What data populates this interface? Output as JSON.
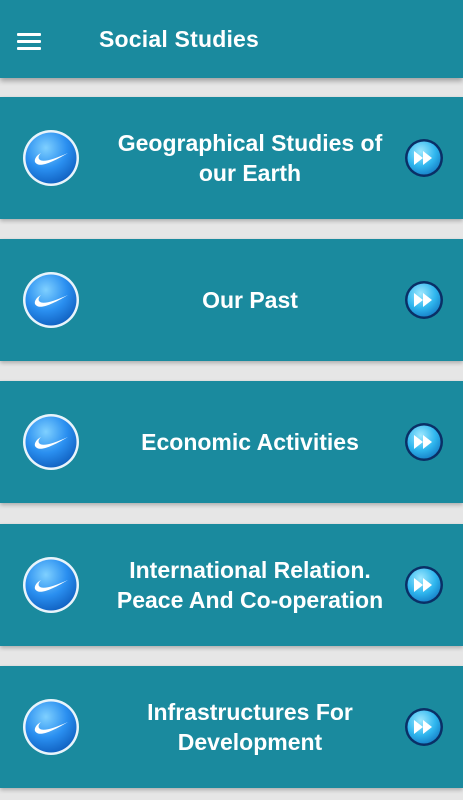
{
  "appbar": {
    "title": "Social Studies",
    "menu_icon": "hamburger-menu-icon"
  },
  "theme": {
    "primary": "#1a8a9e",
    "background": "#e6e6e6",
    "text": "#ffffff",
    "icon_blue": "#1a7fd6"
  },
  "items": [
    {
      "label": "Geographical Studies of our Earth",
      "left_icon": "swoosh-logo-icon",
      "right_icon": "fast-forward-icon"
    },
    {
      "label": "Our Past",
      "left_icon": "swoosh-logo-icon",
      "right_icon": "fast-forward-icon"
    },
    {
      "label": "Economic Activities",
      "left_icon": "swoosh-logo-icon",
      "right_icon": "fast-forward-icon"
    },
    {
      "label": "International Relation. Peace And Co-operation",
      "left_icon": "swoosh-logo-icon",
      "right_icon": "fast-forward-icon"
    },
    {
      "label": "Infrastructures For Development",
      "left_icon": "swoosh-logo-icon",
      "right_icon": "fast-forward-icon"
    }
  ]
}
